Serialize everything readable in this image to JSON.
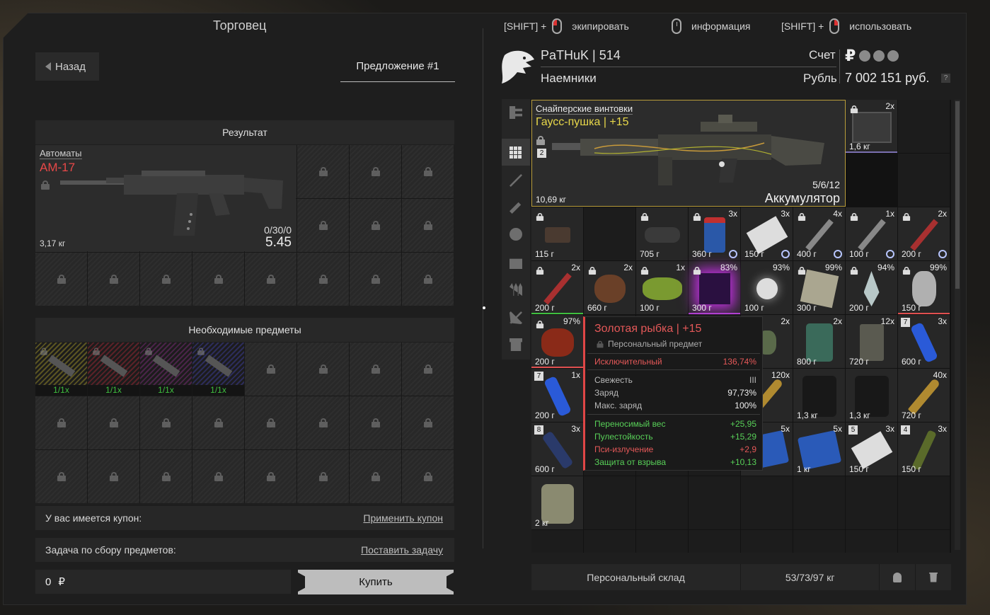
{
  "left": {
    "title": "Торговец",
    "back_label": "Назад",
    "offer_tab": "Предложение #1",
    "result_header": "Результат",
    "result_item": {
      "category": "Автоматы",
      "name": "АМ-17",
      "weight": "3,17 кг",
      "ammo": "0/30/0",
      "caliber": "5.45"
    },
    "required_header": "Необходимые предметы",
    "required_items": [
      {
        "qty": "1/1x",
        "color": "#5a5422"
      },
      {
        "qty": "1/1x",
        "color": "#5a2228"
      },
      {
        "qty": "1/1x",
        "color": "#4a2448"
      },
      {
        "qty": "1/1x",
        "color": "#2c2c5a"
      }
    ],
    "coupon_label": "У вас имеется купон:",
    "coupon_link": "Применить купон",
    "task_label": "Задача по сбору предметов:",
    "task_link": "Поставить задачу",
    "price_value": "0",
    "price_currency": "₽",
    "buy_label": "Купить"
  },
  "hints": [
    {
      "prefix": "[SHIFT] +",
      "mouse": "l",
      "label": "экипировать"
    },
    {
      "prefix": "",
      "mouse": "n",
      "label": "информация"
    },
    {
      "prefix": "[SHIFT] +",
      "mouse": "r",
      "label": "использовать"
    }
  ],
  "account": {
    "player": "PaTHuK | 514",
    "faction": "Наемники",
    "account_label": "Счет",
    "currency_label": "Рубль",
    "currency_symbol": "₽",
    "money": "7 002 151 руб.",
    "help": "?"
  },
  "gauss": {
    "category": "Снайперские винтовки",
    "name": "Гаусс-пушка | +15",
    "badge": "2",
    "weight": "10,69 кг",
    "ammo": "5/6/12",
    "ammo_type": "Аккумулятор"
  },
  "inventory": [
    {
      "r": 0,
      "c": 6,
      "count": "2x",
      "weight": "1,6 кг",
      "lock": true,
      "shape": "case",
      "ul": "#7a6fb0"
    },
    {
      "r": 2,
      "c": 0,
      "count": "",
      "weight": "115 г",
      "lock": true,
      "shape": "scope",
      "ul": ""
    },
    {
      "r": 2,
      "c": 2,
      "count": "",
      "weight": "705 г",
      "lock": true,
      "shape": "scope2",
      "ul": ""
    },
    {
      "r": 2,
      "c": 3,
      "count": "3x",
      "weight": "360 г",
      "lock": true,
      "shape": "jar",
      "clock": true,
      "ul": ""
    },
    {
      "r": 2,
      "c": 4,
      "count": "3x",
      "weight": "150 г",
      "lock": false,
      "shape": "pills",
      "clock": true,
      "ul": ""
    },
    {
      "r": 2,
      "c": 5,
      "count": "4x",
      "weight": "400 г",
      "lock": true,
      "shape": "syringe",
      "clock": true,
      "ul": ""
    },
    {
      "r": 2,
      "c": 6,
      "count": "1x",
      "weight": "100 г",
      "lock": true,
      "shape": "syringe",
      "clock": true,
      "ul": ""
    },
    {
      "r": 2,
      "c": 7,
      "count": "2x",
      "weight": "200 г",
      "lock": true,
      "shape": "syringe-red",
      "clock": true,
      "ul": ""
    },
    {
      "r": 3,
      "c": 0,
      "count": "2x",
      "weight": "200 г",
      "lock": true,
      "shape": "syringe-red",
      "ul": "#3fbf3f"
    },
    {
      "r": 3,
      "c": 1,
      "count": "2x",
      "weight": "660 г",
      "lock": true,
      "shape": "rock",
      "ul": ""
    },
    {
      "r": 3,
      "c": 2,
      "count": "1x",
      "weight": "100 г",
      "lock": true,
      "shape": "slime",
      "ul": ""
    },
    {
      "r": 3,
      "c": 3,
      "count": "83%",
      "weight": "300 г",
      "lock": true,
      "shape": "cube",
      "ul": "#b040d0"
    },
    {
      "r": 3,
      "c": 4,
      "count": "93%",
      "weight": "100 г",
      "lock": false,
      "shape": "orb",
      "ul": ""
    },
    {
      "r": 3,
      "c": 5,
      "count": "99%",
      "weight": "300 г",
      "lock": true,
      "shape": "paper",
      "ul": ""
    },
    {
      "r": 3,
      "c": 6,
      "count": "94%",
      "weight": "200 г",
      "lock": true,
      "shape": "crystal",
      "ul": ""
    },
    {
      "r": 3,
      "c": 7,
      "count": "99%",
      "weight": "150 г",
      "lock": true,
      "shape": "spiral",
      "ul": "#e05050"
    },
    {
      "r": 4,
      "c": 0,
      "count": "97%",
      "weight": "200 г",
      "lock": true,
      "shape": "fish",
      "ul": "#e05050"
    },
    {
      "r": 4,
      "c": 4,
      "count": "2x",
      "weight": "кг",
      "lock": false,
      "shape": "grenade",
      "ul": ""
    },
    {
      "r": 4,
      "c": 5,
      "count": "2x",
      "weight": "800 г",
      "lock": false,
      "shape": "can",
      "ul": ""
    },
    {
      "r": 4,
      "c": 6,
      "count": "12x",
      "weight": "720 г",
      "lock": false,
      "shape": "tin",
      "ul": ""
    },
    {
      "r": 4,
      "c": 7,
      "count": "3x",
      "weight": "600 г",
      "lock": false,
      "badge": "7",
      "shape": "battery",
      "ul": ""
    },
    {
      "r": 5,
      "c": 0,
      "count": "1x",
      "weight": "200 г",
      "lock": false,
      "badge": "7",
      "shape": "battery",
      "ul": ""
    },
    {
      "r": 5,
      "c": 4,
      "count": "120x",
      "weight": "",
      "lock": false,
      "shape": "bullet",
      "ul": ""
    },
    {
      "r": 5,
      "c": 5,
      "count": "",
      "weight": "1,3 кг",
      "lock": false,
      "shape": "plate-dark",
      "ul": ""
    },
    {
      "r": 5,
      "c": 6,
      "count": "",
      "weight": "1,3 кг",
      "lock": false,
      "shape": "plate-dark",
      "ul": ""
    },
    {
      "r": 5,
      "c": 7,
      "count": "40x",
      "weight": "720 г",
      "lock": false,
      "shape": "bullet",
      "ul": ""
    },
    {
      "r": 6,
      "c": 0,
      "count": "3x",
      "weight": "600 г",
      "lock": false,
      "badge": "8",
      "shape": "energy",
      "ul": ""
    },
    {
      "r": 6,
      "c": 4,
      "count": "5x",
      "weight": "",
      "lock": false,
      "shape": "medkit",
      "ul": ""
    },
    {
      "r": 6,
      "c": 5,
      "count": "5x",
      "weight": "1 кг",
      "lock": false,
      "shape": "medkit",
      "ul": ""
    },
    {
      "r": 6,
      "c": 6,
      "count": "3x",
      "weight": "150 г",
      "lock": false,
      "badge": "5",
      "shape": "pills",
      "ul": ""
    },
    {
      "r": 6,
      "c": 7,
      "count": "3x",
      "weight": "150 г",
      "lock": false,
      "badge": "4",
      "shape": "tube",
      "ul": ""
    },
    {
      "r": 7,
      "c": 0,
      "count": "",
      "weight": "2 кг",
      "lock": false,
      "shape": "plate",
      "ul": ""
    }
  ],
  "tooltip": {
    "title": "Золотая рыбка | +15",
    "subtitle": "Персональный предмет",
    "rarity_label": "Исключительный",
    "rarity_value": "136,74%",
    "freshness_label": "Свежесть",
    "freshness_value": "III",
    "charge_label": "Заряд",
    "charge_value": "97,73%",
    "max_charge_label": "Макс. заряд",
    "max_charge_value": "100%",
    "stats": [
      {
        "label": "Переносимый вес",
        "value": "+25,95",
        "color": "green"
      },
      {
        "label": "Пулестойкость",
        "value": "+15,29",
        "color": "green"
      },
      {
        "label": "Пси-излучение",
        "value": "+2,9",
        "color": "red"
      },
      {
        "label": "Защита от взрыва",
        "value": "+10,13",
        "color": "green"
      }
    ]
  },
  "storage": {
    "label": "Персональный склад",
    "weight": "53/73/97 кг"
  }
}
